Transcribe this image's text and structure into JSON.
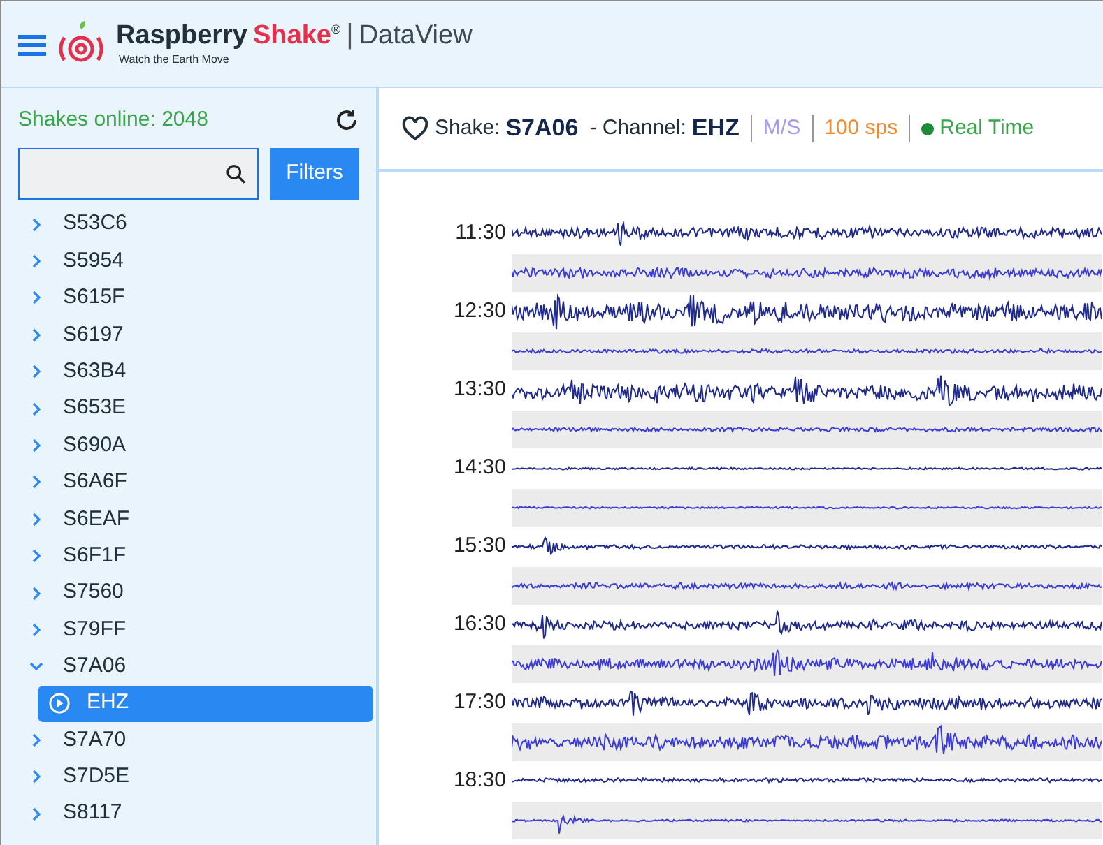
{
  "header": {
    "brand_main": "Raspberry",
    "brand_accent": "Shake",
    "brand_mark": "®",
    "separator": "|",
    "app_name": "DataView",
    "tagline": "Watch the Earth Move"
  },
  "sidebar": {
    "online": "Shakes online: 2048",
    "filters_button": "Filters",
    "items": [
      {
        "label": "S53C6",
        "expanded": false
      },
      {
        "label": "S5954",
        "expanded": false
      },
      {
        "label": "S615F",
        "expanded": false
      },
      {
        "label": "S6197",
        "expanded": false
      },
      {
        "label": "S63B4",
        "expanded": false
      },
      {
        "label": "S653E",
        "expanded": false
      },
      {
        "label": "S690A",
        "expanded": false
      },
      {
        "label": "S6A6F",
        "expanded": false
      },
      {
        "label": "S6EAF",
        "expanded": false
      },
      {
        "label": "S6F1F",
        "expanded": false
      },
      {
        "label": "S7560",
        "expanded": false
      },
      {
        "label": "S79FF",
        "expanded": false
      },
      {
        "label": "S7A06",
        "expanded": true,
        "children": [
          {
            "label": "EHZ",
            "selected": true
          }
        ]
      },
      {
        "label": "S7A70",
        "expanded": false
      },
      {
        "label": "S7D5E",
        "expanded": false
      },
      {
        "label": "S8117",
        "expanded": false
      }
    ]
  },
  "channel_bar": {
    "shake_label": "Shake:",
    "shake": "S7A06",
    "channel_label": "- Channel:",
    "channel": "EHZ",
    "unit": "M/S",
    "rate": "100 sps",
    "mode": "Real Time",
    "live": true
  },
  "helicorder": {
    "time_labels": [
      "11:30",
      "12:30",
      "13:30",
      "14:30",
      "15:30",
      "16:30",
      "17:30",
      "18:30"
    ]
  }
}
